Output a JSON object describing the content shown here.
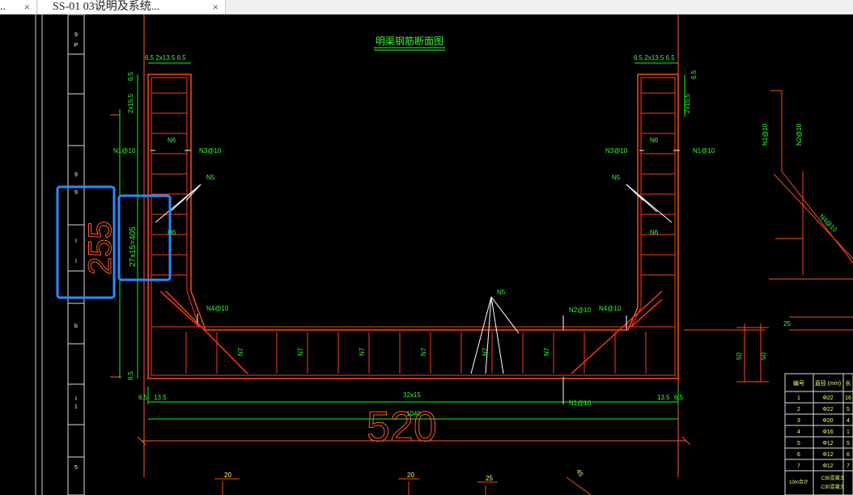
{
  "tabs": [
    {
      "label": "..",
      "close": "×",
      "active": false
    },
    {
      "label": "SS-01  03说明及系统...",
      "close": "×",
      "active": true
    }
  ],
  "drawing": {
    "title": "明渠钢筋断面图",
    "dim_top_left": "6.5 2x13.5 6.5",
    "dim_top_right": "6.5 2x13.5 6.5",
    "dim_top_v_left": "6.5",
    "dim_top_v_right": "6.5",
    "dim_v_2x15_left": "2x15.5",
    "dim_v_2x15_right": "2x15.5",
    "dim_v_27x15": "27x15=405",
    "dim_v_255": "255",
    "dim_v_65_bottom": "6.5",
    "label_n1_left": "N1@10",
    "label_n1_right": "N1@10",
    "label_n3_left": "N3@10",
    "label_n3_right": "N3@10",
    "label_n6": "N6",
    "label_n5": "N5",
    "label_n4_left": "N4@10",
    "label_n4_right": "N4@10",
    "label_n2": "N2@10",
    "label_n7": "N7",
    "label_n1_bottom": "N1@10",
    "dim_bottom_left": "6.5",
    "dim_bottom_135_left": "13.5",
    "dim_bottom_135_right": "13.5",
    "dim_bottom_right": "6.5",
    "dim_bottom_32x15": "32x15",
    "dim_bottom_1040": "1040",
    "dim_bottom_520": "520",
    "dim_50_a": "50",
    "dim_50_b": "50",
    "dim_25_right": "25",
    "dim_20_a": "20",
    "dim_20_b": "20",
    "dim_25_bottom": "25",
    "dim_45_bottom": "45",
    "detail_n1": "N1@10",
    "detail_n2": "N2@10",
    "detail_n4": "N4@10"
  },
  "table": {
    "header": [
      "编号",
      "直径 (mm)",
      "长"
    ],
    "rows": [
      [
        "1",
        "Φ22",
        "16"
      ],
      [
        "2",
        "Φ22",
        "5"
      ],
      [
        "3",
        "Φ20",
        "4"
      ],
      [
        "4",
        "Φ16",
        "1"
      ],
      [
        "5",
        "Φ12",
        "5"
      ],
      [
        "6",
        "Φ12",
        "6"
      ],
      [
        "7",
        "Φ12",
        "7"
      ]
    ],
    "footer_left": "10m合计",
    "footer_right_1": "C35混凝土",
    "footer_right_2": "C30混凝土"
  },
  "ruler": {
    "marks": [
      "9",
      "P",
      "9",
      "9",
      "I",
      "I",
      "b",
      "I",
      "1",
      "5"
    ]
  },
  "colors": {
    "background": "#000000",
    "concrete": "#ff4a1c",
    "rebar": "#ff3b10",
    "dimension": "#00ff00",
    "text_green": "#33ff33",
    "white": "#ffffff",
    "highlight": "#2a8cff"
  }
}
